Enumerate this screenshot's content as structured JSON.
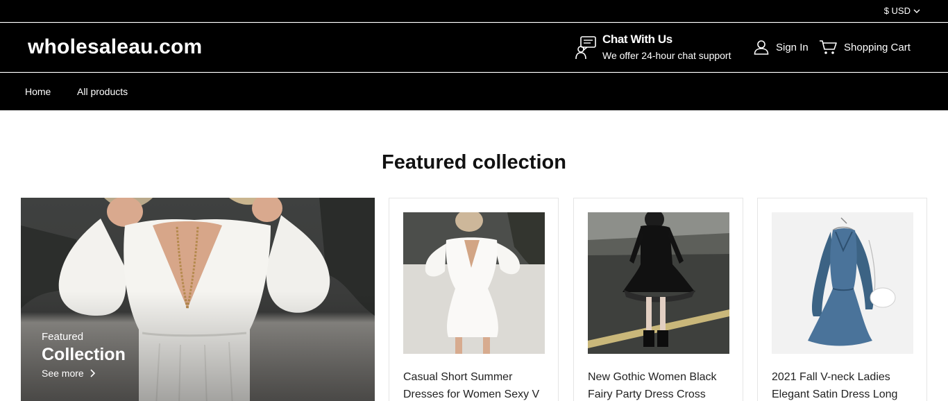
{
  "topbar": {
    "currency": "$ USD"
  },
  "header": {
    "logo": "wholesaleau.com",
    "chat": {
      "title": "Chat With Us",
      "subtitle": "We offer 24-hour chat support"
    },
    "sign_in": "Sign In",
    "cart": "Shopping Cart"
  },
  "nav": {
    "items": [
      {
        "label": "Home"
      },
      {
        "label": "All products"
      }
    ]
  },
  "main": {
    "section_title": "Featured collection",
    "hero": {
      "kicker": "Featured",
      "title": "Collection",
      "link": "See more"
    },
    "products": [
      {
        "title": "Casual Short Summer Dresses for Women Sexy V"
      },
      {
        "title": "New Gothic Women Black Fairy Party Dress Cross"
      },
      {
        "title": "2021 Fall V-neck Ladies Elegant Satin Dress Long"
      }
    ]
  },
  "colors": {
    "header_bg": "#000000",
    "text_on_dark": "#ffffff",
    "card_border": "#e5e5e5"
  },
  "icons": [
    "chevron-down-icon",
    "chat-support-icon",
    "user-icon",
    "cart-icon",
    "chevron-right-icon"
  ]
}
